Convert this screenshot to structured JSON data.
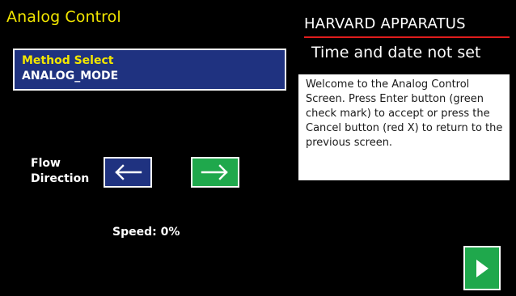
{
  "screen": {
    "title": "Analog Control"
  },
  "method": {
    "label": "Method Select",
    "value": "ANALOG_MODE"
  },
  "flow": {
    "label_line1": "Flow",
    "label_line2": "Direction",
    "left_icon": "left-arrow-icon",
    "right_icon": "right-arrow-icon"
  },
  "speed": {
    "text": "Speed: 0%"
  },
  "brand": {
    "name": "HARVARD APPARATUS"
  },
  "status": {
    "datetime": "Time and date not set"
  },
  "info": {
    "message": "Welcome to the Analog Control Screen. Press Enter button (green check mark) to accept or press the Cancel button (red X) to return to the previous screen."
  },
  "actions": {
    "play_icon": "play-icon"
  },
  "colors": {
    "background": "#000000",
    "title": "#f2e600",
    "panel_blue": "#1f3280",
    "button_green": "#1fa84c",
    "brand_line": "#e01c1c",
    "text_white": "#ffffff"
  }
}
